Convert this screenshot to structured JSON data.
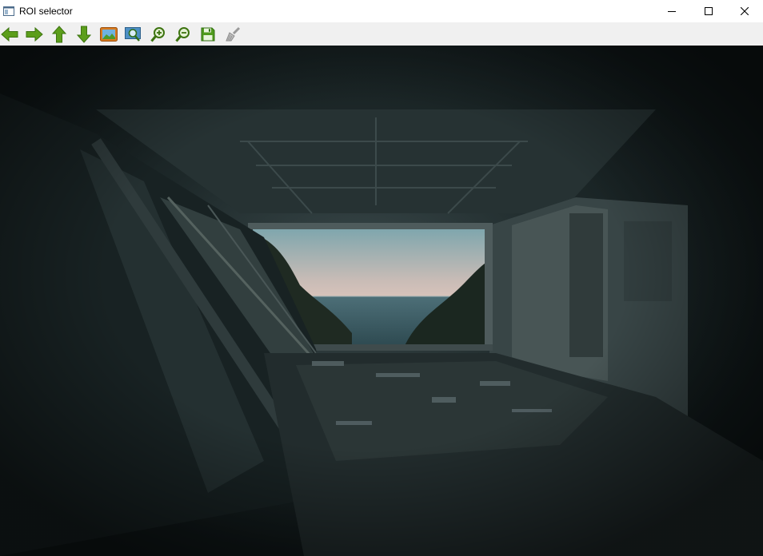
{
  "window": {
    "title": "ROI selector",
    "controls": {
      "minimize_icon": "minimize-icon",
      "maximize_icon": "maximize-icon",
      "close_icon": "close-icon"
    }
  },
  "toolbar": {
    "buttons": [
      {
        "icon": "arrow-left-icon"
      },
      {
        "icon": "arrow-right-icon"
      },
      {
        "icon": "arrow-up-icon"
      },
      {
        "icon": "arrow-down-icon"
      },
      {
        "icon": "picture-icon"
      },
      {
        "icon": "zoom-fit-icon"
      },
      {
        "icon": "zoom-in-icon"
      },
      {
        "icon": "zoom-out-icon"
      },
      {
        "icon": "save-icon"
      },
      {
        "icon": "clear-brush-icon"
      }
    ]
  },
  "colors": {
    "titlebar_bg": "#ffffff",
    "toolbar_bg": "#f0f0f0",
    "arrow_green": "#5c9e1b",
    "image_bg": "#141e1f"
  }
}
